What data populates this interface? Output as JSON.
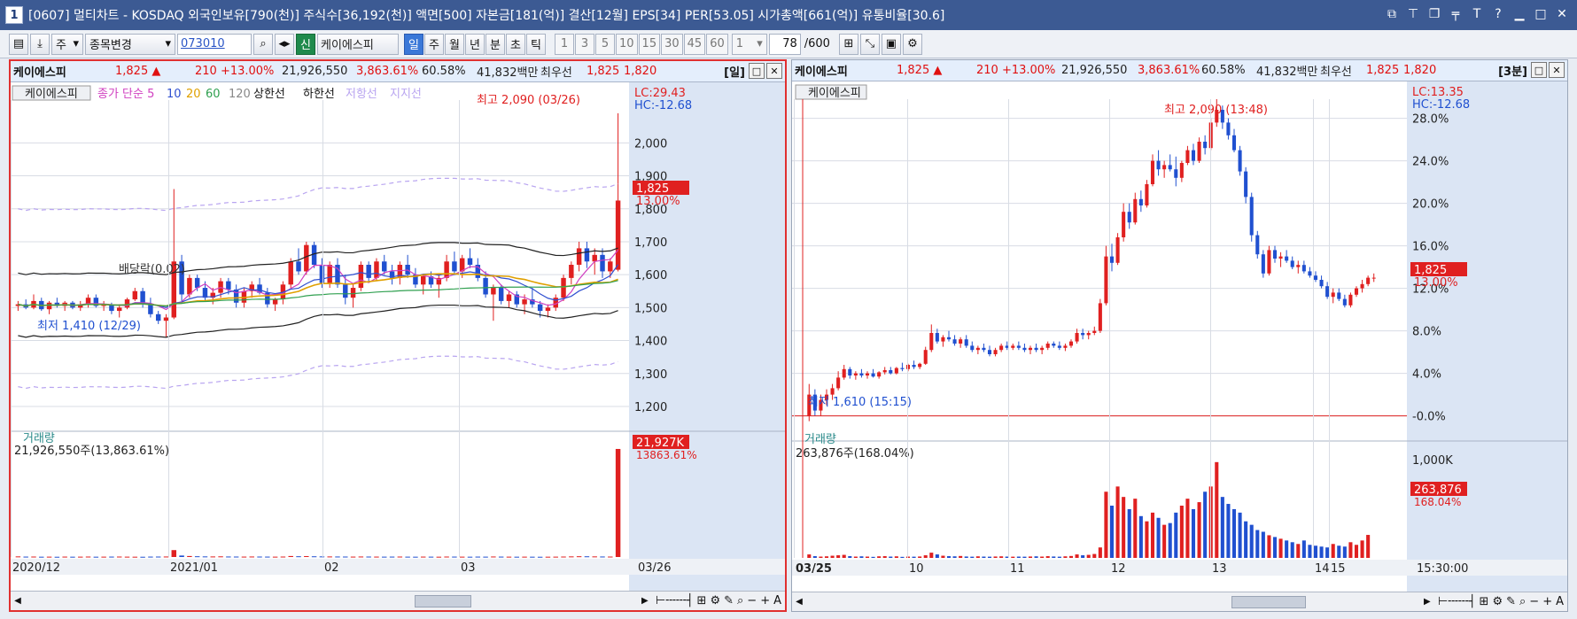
{
  "window": {
    "number": "1",
    "title": "[0607] 멀티차트 - KOSDAQ 외국인보유[790(천)] 주식수[36,192(천)] 액면[500] 자본금[181(억)] 결산[12월] EPS[34] PER[53.05] 시가총액[661(억)] 유통비율[30.6]"
  },
  "toolbar": {
    "unit_select": "주",
    "change_select": "종목변경",
    "code": "073010",
    "search_name": "케이에스피",
    "new_badge": "신",
    "periods": [
      "일",
      "주",
      "월",
      "년",
      "분",
      "초",
      "틱"
    ],
    "active_period": "일",
    "intervals": [
      "1",
      "3",
      "5",
      "10",
      "15",
      "30",
      "45",
      "60"
    ],
    "interval_value": "1",
    "count": "78",
    "count_total": "/600"
  },
  "left": {
    "quote": {
      "name": "케이에스피",
      "price": "1,825 ▲",
      "change": "210 +13.00%",
      "volume": "21,926,550",
      "vol_ratio": "3,863.61%",
      "rate": "60.58%",
      "amount": "41,832백만",
      "label": "최우선",
      "ask": "1,825",
      "bid": "1,820",
      "tag": "[일]"
    },
    "legend": {
      "name": "케이에스피",
      "ma": "종가 단순 5",
      "ma10": "10",
      "ma20": "20",
      "ma60": "60",
      "ma120": "120",
      "upper": "상한선",
      "lower": "하한선",
      "resist": "저항선",
      "support": "지지선"
    },
    "lc": "LC:29.43",
    "hc": "HC:-12.68",
    "price_tag": "1,825",
    "pct_tag": "13.00%",
    "high_note": "최고 2,090 (03/26)",
    "low_note": "최저 1,410 (12/29)",
    "div_note": "배당락(0.02)",
    "vol_title": "거래량",
    "vol_note": "21,926,550주(13,863.61%)",
    "vol_tag": "21,927K",
    "vol_pct": "13863.61%",
    "x_labels": [
      "2020/12",
      "2021/01",
      "02",
      "03"
    ],
    "x_end": "03/26"
  },
  "right": {
    "quote": {
      "name": "케이에스피",
      "price": "1,825 ▲",
      "change": "210 +13.00%",
      "volume": "21,926,550",
      "vol_ratio": "3,863.61%",
      "rate": "60.58%",
      "amount": "41,832백만",
      "label": "최우선",
      "ask": "1,825",
      "bid": "1,820",
      "tag": "[3분]"
    },
    "legend_name": "케이에스피",
    "lc": "LC:13.35",
    "hc": "HC:-12.68",
    "price_tag": "1,825",
    "pct_tag": "13.00%",
    "high_note": "최고 2,090 (13:48)",
    "low_note": "최저 1,610 (15:15)",
    "vol_title": "거래량",
    "vol_note": "263,876주(168.04%)",
    "vol_tag": "263,876",
    "vol_pct": "168.04%",
    "x_labels": [
      "03/25",
      "10",
      "11",
      "12",
      "13",
      "14",
      "15"
    ],
    "x_end": "15:30:00"
  },
  "chart_data": [
    {
      "type": "candlestick",
      "title": "케이에스피 일봉",
      "y_ticks": [
        1200,
        1300,
        1400,
        1500,
        1600,
        1700,
        1800,
        1900,
        2000
      ],
      "ylim": [
        1130,
        2130
      ],
      "colors": {
        "up": "#e02020",
        "down": "#2050d0"
      },
      "candles": [
        [
          1505,
          1520,
          1490,
          1510
        ],
        [
          1510,
          1525,
          1495,
          1500
        ],
        [
          1500,
          1540,
          1495,
          1520
        ],
        [
          1520,
          1530,
          1490,
          1495
        ],
        [
          1495,
          1520,
          1480,
          1515
        ],
        [
          1515,
          1530,
          1500,
          1505
        ],
        [
          1505,
          1520,
          1490,
          1515
        ],
        [
          1515,
          1520,
          1495,
          1500
        ],
        [
          1500,
          1520,
          1490,
          1510
        ],
        [
          1510,
          1540,
          1500,
          1530
        ],
        [
          1530,
          1540,
          1500,
          1505
        ],
        [
          1505,
          1520,
          1490,
          1510
        ],
        [
          1510,
          1515,
          1480,
          1490
        ],
        [
          1490,
          1510,
          1470,
          1500
        ],
        [
          1500,
          1530,
          1495,
          1525
        ],
        [
          1525,
          1560,
          1520,
          1550
        ],
        [
          1550,
          1560,
          1500,
          1510
        ],
        [
          1510,
          1530,
          1470,
          1480
        ],
        [
          1480,
          1490,
          1450,
          1460
        ],
        [
          1460,
          1480,
          1410,
          1470
        ],
        [
          1470,
          1860,
          1465,
          1640
        ],
        [
          1640,
          1660,
          1520,
          1540
        ],
        [
          1540,
          1600,
          1530,
          1590
        ],
        [
          1590,
          1600,
          1550,
          1560
        ],
        [
          1560,
          1580,
          1520,
          1530
        ],
        [
          1530,
          1560,
          1510,
          1545
        ],
        [
          1545,
          1590,
          1530,
          1580
        ],
        [
          1580,
          1590,
          1540,
          1555
        ],
        [
          1555,
          1570,
          1500,
          1515
        ],
        [
          1515,
          1560,
          1500,
          1550
        ],
        [
          1550,
          1580,
          1530,
          1570
        ],
        [
          1570,
          1590,
          1540,
          1545
        ],
        [
          1545,
          1560,
          1500,
          1510
        ],
        [
          1510,
          1530,
          1490,
          1525
        ],
        [
          1525,
          1580,
          1510,
          1570
        ],
        [
          1570,
          1650,
          1560,
          1640
        ],
        [
          1640,
          1680,
          1600,
          1610
        ],
        [
          1610,
          1700,
          1600,
          1690
        ],
        [
          1690,
          1700,
          1620,
          1630
        ],
        [
          1630,
          1650,
          1560,
          1575
        ],
        [
          1575,
          1640,
          1560,
          1630
        ],
        [
          1630,
          1650,
          1560,
          1570
        ],
        [
          1570,
          1600,
          1510,
          1530
        ],
        [
          1530,
          1570,
          1500,
          1560
        ],
        [
          1560,
          1640,
          1550,
          1630
        ],
        [
          1630,
          1640,
          1580,
          1590
        ],
        [
          1590,
          1650,
          1580,
          1640
        ],
        [
          1640,
          1660,
          1600,
          1610
        ],
        [
          1610,
          1630,
          1570,
          1590
        ],
        [
          1590,
          1640,
          1570,
          1630
        ],
        [
          1630,
          1660,
          1590,
          1600
        ],
        [
          1600,
          1620,
          1560,
          1570
        ],
        [
          1570,
          1600,
          1540,
          1595
        ],
        [
          1595,
          1610,
          1560,
          1570
        ],
        [
          1570,
          1600,
          1530,
          1590
        ],
        [
          1590,
          1660,
          1580,
          1640
        ],
        [
          1640,
          1670,
          1600,
          1610
        ],
        [
          1610,
          1660,
          1590,
          1650
        ],
        [
          1650,
          1680,
          1620,
          1630
        ],
        [
          1630,
          1650,
          1580,
          1590
        ],
        [
          1590,
          1610,
          1530,
          1540
        ],
        [
          1540,
          1570,
          1460,
          1560
        ],
        [
          1560,
          1570,
          1510,
          1520
        ],
        [
          1520,
          1550,
          1500,
          1540
        ],
        [
          1540,
          1550,
          1500,
          1510
        ],
        [
          1510,
          1540,
          1480,
          1525
        ],
        [
          1525,
          1560,
          1500,
          1510
        ],
        [
          1510,
          1520,
          1470,
          1490
        ],
        [
          1490,
          1510,
          1470,
          1500
        ],
        [
          1500,
          1540,
          1490,
          1530
        ],
        [
          1530,
          1600,
          1520,
          1590
        ],
        [
          1590,
          1640,
          1570,
          1630
        ],
        [
          1630,
          1700,
          1610,
          1680
        ],
        [
          1680,
          1700,
          1620,
          1640
        ],
        [
          1640,
          1680,
          1600,
          1660
        ],
        [
          1660,
          1680,
          1590,
          1610
        ],
        [
          1610,
          1650,
          1590,
          1640
        ],
        [
          1615,
          2090,
          1610,
          1825
        ]
      ],
      "volume": [
        120,
        80,
        90,
        60,
        70,
        50,
        80,
        60,
        70,
        90,
        60,
        70,
        80,
        90,
        70,
        60,
        50,
        80,
        90,
        100,
        1400,
        300,
        200,
        150,
        120,
        110,
        130,
        100,
        90,
        80,
        100,
        90,
        80,
        70,
        90,
        200,
        150,
        180,
        140,
        120,
        110,
        100,
        90,
        80,
        100,
        90,
        80,
        70,
        80,
        90,
        70,
        60,
        80,
        70,
        60,
        90,
        80,
        70,
        60,
        80,
        70,
        100,
        80,
        70,
        60,
        70,
        60,
        50,
        60,
        70,
        90,
        120,
        150,
        140,
        120,
        100,
        90,
        21927
      ],
      "volume_max": 23000
    },
    {
      "type": "candlestick",
      "title": "케이에스피 3분봉",
      "y_ticks_pct": [
        "-0.0%",
        "4.0%",
        "8.0%",
        "12.0%",
        "16.0%",
        "20.0%",
        "24.0%",
        "28.0%"
      ],
      "ylim_pct": [
        -1.2,
        29.8
      ],
      "colors": {
        "up": "#e02020",
        "down": "#2050d0"
      },
      "candles": [
        [
          0,
          3,
          -0.5,
          2
        ],
        [
          2,
          2.5,
          0,
          0.5
        ],
        [
          0.5,
          2,
          0,
          1.5
        ],
        [
          1.5,
          2.5,
          1,
          2
        ],
        [
          2,
          3,
          1.5,
          2.6
        ],
        [
          2.6,
          4.2,
          2.4,
          3.6
        ],
        [
          3.6,
          4.8,
          3.4,
          4.4
        ],
        [
          4.4,
          4.6,
          3.5,
          3.8
        ],
        [
          3.8,
          4.2,
          3.4,
          4
        ],
        [
          4,
          4.4,
          3.6,
          3.8
        ],
        [
          3.8,
          4.2,
          3.5,
          4
        ],
        [
          4,
          4.4,
          3.6,
          3.7
        ],
        [
          3.7,
          4.2,
          3.5,
          4.1
        ],
        [
          4.1,
          4.6,
          3.9,
          4.3
        ],
        [
          4.3,
          4.6,
          3.9,
          4
        ],
        [
          4,
          4.6,
          3.9,
          4.5
        ],
        [
          4.5,
          5,
          4.2,
          4.4
        ],
        [
          4.4,
          4.9,
          4.2,
          4.8
        ],
        [
          4.8,
          5.2,
          4.4,
          4.6
        ],
        [
          4.6,
          5,
          4.4,
          4.9
        ],
        [
          4.9,
          6.5,
          4.8,
          6.2
        ],
        [
          6.2,
          8.6,
          6,
          7.8
        ],
        [
          7.8,
          8.2,
          6.8,
          7
        ],
        [
          7,
          7.6,
          6.5,
          7.4
        ],
        [
          7.4,
          8,
          7,
          7.2
        ],
        [
          7.2,
          7.6,
          6.6,
          6.8
        ],
        [
          6.8,
          7.4,
          6.4,
          7.2
        ],
        [
          7.2,
          7.6,
          6.4,
          6.6
        ],
        [
          6.6,
          7,
          6,
          6.2
        ],
        [
          6.2,
          6.6,
          5.8,
          6.4
        ],
        [
          6.4,
          6.8,
          6,
          6.2
        ],
        [
          6.2,
          6.6,
          5.6,
          5.8
        ],
        [
          5.8,
          6.4,
          5.6,
          6.2
        ],
        [
          6.2,
          6.8,
          6,
          6.6
        ],
        [
          6.6,
          7,
          6.2,
          6.4
        ],
        [
          6.4,
          6.8,
          6.2,
          6.6
        ],
        [
          6.6,
          7,
          6.2,
          6.4
        ],
        [
          6.4,
          6.8,
          6,
          6.2
        ],
        [
          6.2,
          6.6,
          5.8,
          6.4
        ],
        [
          6.4,
          6.8,
          6,
          6.2
        ],
        [
          6.2,
          6.6,
          5.8,
          6.4
        ],
        [
          6.4,
          7,
          6.2,
          6.8
        ],
        [
          6.8,
          7,
          6.4,
          6.6
        ],
        [
          6.6,
          7,
          6.2,
          6.4
        ],
        [
          6.4,
          6.8,
          6.1,
          6.6
        ],
        [
          6.6,
          7.2,
          6.4,
          7
        ],
        [
          7,
          8.2,
          6.8,
          7.8
        ],
        [
          7.8,
          8.2,
          7.2,
          7.6
        ],
        [
          7.6,
          8,
          7.2,
          7.8
        ],
        [
          7.8,
          8.4,
          7.6,
          8
        ],
        [
          8,
          11,
          7.8,
          10.6
        ],
        [
          10.6,
          16,
          10.4,
          15
        ],
        [
          15,
          16.2,
          13.6,
          14.4
        ],
        [
          14.4,
          17.2,
          14.2,
          16.8
        ],
        [
          16.8,
          20,
          16.4,
          19.2
        ],
        [
          19.2,
          20,
          17.6,
          18.2
        ],
        [
          18.2,
          21,
          18,
          20.4
        ],
        [
          20.4,
          21.2,
          19.2,
          19.8
        ],
        [
          19.8,
          22.2,
          19.6,
          21.8
        ],
        [
          21.8,
          24.6,
          21.6,
          24
        ],
        [
          24,
          25,
          22.6,
          23.2
        ],
        [
          23.2,
          24,
          22.4,
          23.6
        ],
        [
          23.6,
          24.6,
          23,
          23.2
        ],
        [
          23.2,
          24.4,
          21.6,
          22.4
        ],
        [
          22.4,
          24,
          22,
          23.8
        ],
        [
          23.8,
          25.4,
          23.6,
          25
        ],
        [
          25,
          25.6,
          23.6,
          24
        ],
        [
          24,
          26.2,
          23.8,
          25.8
        ],
        [
          25.8,
          26.4,
          24.6,
          25.2
        ],
        [
          25.2,
          28,
          25,
          27.6
        ],
        [
          27.6,
          29.8,
          27.2,
          28.8
        ],
        [
          28.8,
          29.2,
          27,
          27.6
        ],
        [
          27.6,
          28,
          26,
          26.4
        ],
        [
          26.4,
          27,
          24.8,
          25
        ],
        [
          25,
          25.4,
          22.6,
          23
        ],
        [
          23,
          23.4,
          20,
          20.6
        ],
        [
          20.6,
          21,
          16.4,
          17
        ],
        [
          17,
          17.4,
          14.8,
          15.2
        ],
        [
          15.2,
          15.6,
          13,
          13.4
        ],
        [
          13.4,
          16,
          13.2,
          15.6
        ],
        [
          15.6,
          16,
          14.4,
          14.8
        ],
        [
          14.8,
          15.4,
          14,
          15
        ],
        [
          15,
          15.6,
          14.4,
          14.6
        ],
        [
          14.6,
          15,
          13.8,
          14
        ],
        [
          14,
          14.6,
          13.4,
          14.2
        ],
        [
          14.2,
          14.6,
          13.4,
          13.6
        ],
        [
          13.6,
          14,
          13,
          13.2
        ],
        [
          13.2,
          13.6,
          12.6,
          12.8
        ],
        [
          12.8,
          13.2,
          12,
          12.2
        ],
        [
          12.2,
          12.6,
          11,
          11.2
        ],
        [
          11.2,
          12,
          10.6,
          11.6
        ],
        [
          11.6,
          12,
          10.8,
          11
        ],
        [
          11,
          11.4,
          10.2,
          10.4
        ],
        [
          10.4,
          11.6,
          10.2,
          11.4
        ],
        [
          11.4,
          12.2,
          11.2,
          12
        ],
        [
          12,
          12.8,
          11.6,
          12.4
        ],
        [
          12.4,
          13.2,
          12.2,
          13
        ],
        [
          13,
          13.4,
          12.6,
          13
        ]
      ],
      "volume": [
        40,
        20,
        15,
        18,
        25,
        30,
        35,
        20,
        15,
        18,
        15,
        12,
        18,
        20,
        15,
        18,
        12,
        15,
        14,
        16,
        30,
        60,
        40,
        25,
        20,
        18,
        22,
        16,
        14,
        18,
        15,
        14,
        16,
        18,
        15,
        14,
        15,
        14,
        16,
        18,
        15,
        20,
        16,
        14,
        18,
        22,
        40,
        30,
        35,
        45,
        120,
        760,
        600,
        820,
        700,
        560,
        680,
        480,
        420,
        520,
        460,
        380,
        400,
        520,
        600,
        680,
        560,
        640,
        760,
        820,
        1100,
        700,
        620,
        560,
        520,
        420,
        380,
        320,
        300,
        260,
        240,
        220,
        200,
        180,
        160,
        200,
        150,
        140,
        130,
        120,
        160,
        140,
        130,
        180,
        150,
        200,
        264
      ],
      "volume_max": 1200
    }
  ]
}
